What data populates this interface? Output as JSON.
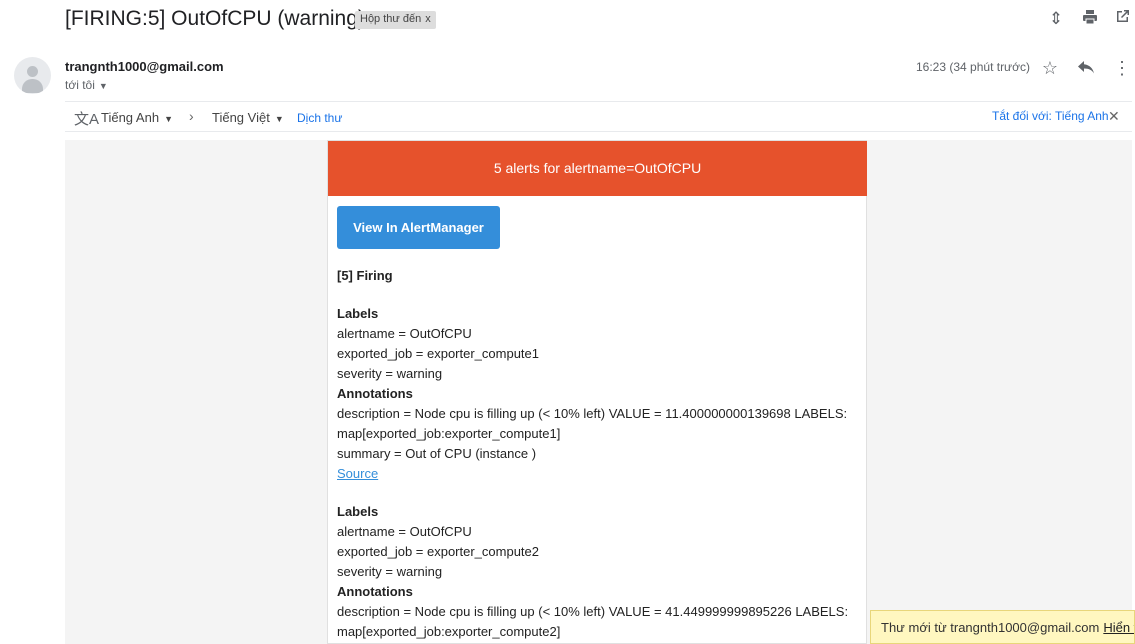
{
  "subject": "[FIRING:5] OutOfCPU (warning)",
  "label_chip": "Hộp thư đến",
  "label_chip_close": "x",
  "top_icons": [
    "collapse-icon",
    "print-icon",
    "open-new-window-icon"
  ],
  "sender": {
    "email": "trangnth1000@gmail.com",
    "to": "tới tôi",
    "time": "16:23 (34 phút trước)"
  },
  "header_icons": [
    "star-icon",
    "reply-icon",
    "more-vert-icon"
  ],
  "translate": {
    "from": "Tiếng Anh",
    "to": "Tiếng Việt",
    "action": "Dịch thư",
    "turn_off": "Tắt đối với: Tiếng Anh"
  },
  "email": {
    "banner": "5 alerts for alertname=OutOfCPU",
    "button": "View In AlertManager",
    "firing_title": "[5] Firing",
    "alerts": [
      {
        "labels_title": "Labels",
        "alertname": "alertname = OutOfCPU",
        "job": "exported_job = exporter_compute1",
        "severity": "severity = warning",
        "annotations_title": "Annotations",
        "description": "description = Node cpu is filling up (< 10% left) VALUE = 11.400000000139698 LABELS: map[exported_job:exporter_compute1]",
        "summary": "summary = Out of CPU (instance )",
        "source": "Source"
      },
      {
        "labels_title": "Labels",
        "alertname": "alertname = OutOfCPU",
        "job": "exported_job = exporter_compute2",
        "severity": "severity = warning",
        "annotations_title": "Annotations",
        "description": "description = Node cpu is filling up (< 10% left) VALUE = 41.449999999895226 LABELS: map[exported_job:exporter_compute2]"
      }
    ]
  },
  "toast": {
    "text": "Thư mới từ trangnth1000@gmail.com",
    "link": "Hiển th"
  },
  "colors": {
    "banner": "#e6522c",
    "button": "#348eda",
    "link": "#1a73e8"
  }
}
